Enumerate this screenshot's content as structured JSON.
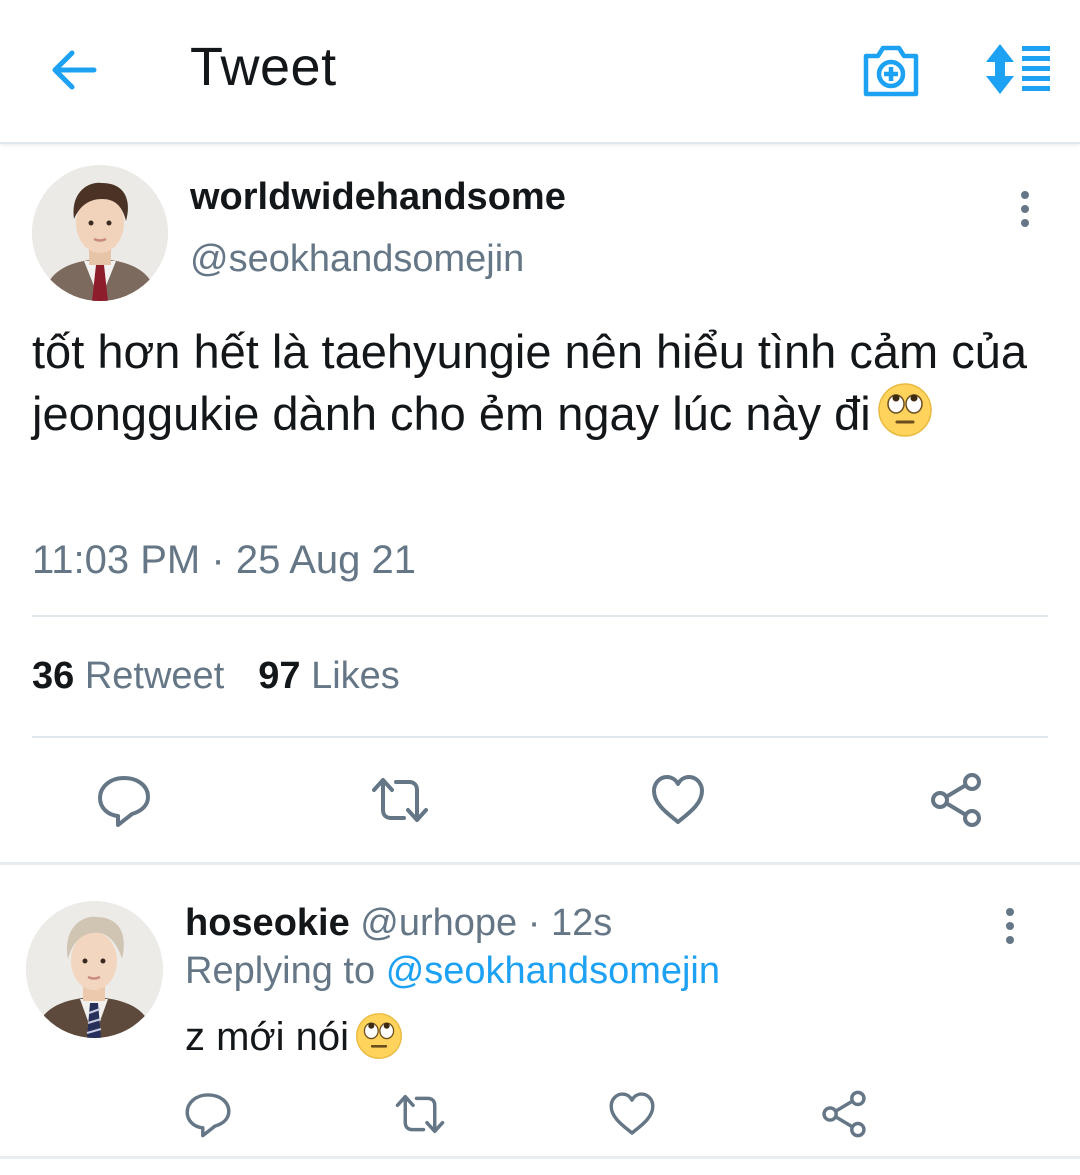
{
  "header": {
    "title": "Tweet",
    "back_icon": "arrow-left-icon",
    "camera_icon": "camera-add-icon",
    "sort_icon": "sort-icon",
    "accent_color": "#1da1f2"
  },
  "tweet": {
    "display_name": "worldwidehandsome",
    "handle": "@seokhandsomejin",
    "text": "tốt hơn hết là taehyungie nên hiểu tình cảm của jeonggukie dành cho ẻm ngay lúc này đi",
    "emoji": "face-with-rolling-eyes",
    "time": "11:03 PM",
    "separator": "·",
    "date": "25 Aug 21",
    "retweets_count": "36",
    "retweets_label": "Retweet",
    "likes_count": "97",
    "likes_label": "Likes"
  },
  "reply": {
    "display_name": "hoseokie",
    "handle": "@urhope",
    "separator": "·",
    "time_ago": "12s",
    "replying_to_label": "Replying to",
    "replying_to_handle": "@seokhandsomejin",
    "text": "z mới nói",
    "emoji": "face-with-rolling-eyes"
  },
  "colors": {
    "text_primary": "#14171a",
    "text_secondary": "#657786",
    "link": "#1da1f2",
    "divider": "#e1e8ed"
  }
}
